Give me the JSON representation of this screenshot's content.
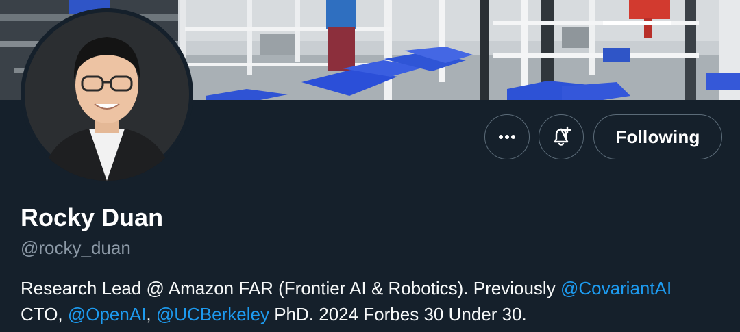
{
  "banner": {
    "description_icon": "warehouse-robotics-banner"
  },
  "avatar": {
    "icon": "profile-photo"
  },
  "actions": {
    "more_icon": "more-dots-icon",
    "notify_icon": "bell-plus-icon",
    "following_label": "Following"
  },
  "profile": {
    "display_name": "Rocky Duan",
    "handle": "@rocky_duan"
  },
  "bio": {
    "line1_text": "Research Lead @ Amazon FAR (Frontier AI & Robotics). Previously ",
    "line1_mention": "@CovariantAI",
    "line2_prefix": "CTO, ",
    "line2_mention1": "@OpenAI",
    "line2_sep": ", ",
    "line2_mention2": "@UCBerkeley",
    "line2_suffix": " PhD. 2024 Forbes 30 Under 30."
  },
  "colors": {
    "background": "#15202b",
    "link": "#1d9bf0",
    "secondary_text": "#8b98a5",
    "button_border": "#5b6b78"
  }
}
